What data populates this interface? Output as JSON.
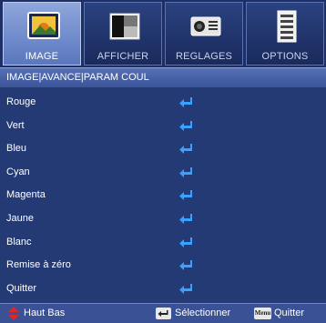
{
  "tabs": [
    {
      "label": "IMAGE",
      "icon": "image-icon",
      "active": true
    },
    {
      "label": "AFFICHER",
      "icon": "display-icon",
      "active": false
    },
    {
      "label": "REGLAGES",
      "icon": "projector-icon",
      "active": false
    },
    {
      "label": "OPTIONS",
      "icon": "options-icon",
      "active": false
    }
  ],
  "breadcrumb": "IMAGE|AVANCE|PARAM COUL",
  "items": [
    {
      "label": "Rouge"
    },
    {
      "label": "Vert"
    },
    {
      "label": "Bleu"
    },
    {
      "label": "Cyan"
    },
    {
      "label": "Magenta"
    },
    {
      "label": "Jaune"
    },
    {
      "label": "Blanc"
    },
    {
      "label": "Remise à zéro"
    },
    {
      "label": "Quitter"
    }
  ],
  "footer": {
    "nav_label": "Haut Bas",
    "select_label": "Sélectionner",
    "menu_key_label": "Menu",
    "quit_label": "Quitter"
  },
  "colors": {
    "background": "#243a74",
    "active_tab": "#7a93d0",
    "enter_arrow": "#3aa0ff",
    "nav_arrow": "#e0262b"
  }
}
